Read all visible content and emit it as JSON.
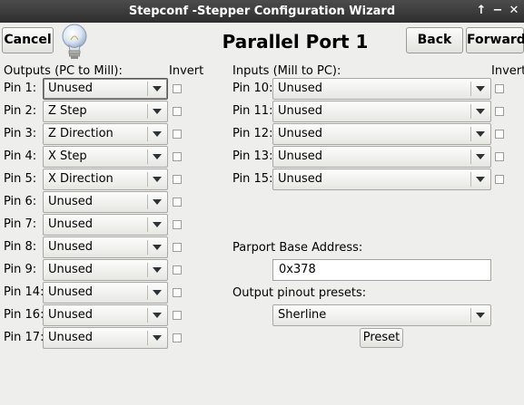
{
  "window": {
    "title": "Stepconf -Stepper Configuration Wizard",
    "controls": [
      "↑",
      "−",
      "✕"
    ]
  },
  "toolbar": {
    "cancel_label": "Cancel",
    "page_title": "Parallel Port 1",
    "back_label": "Back",
    "forward_label": "Forward"
  },
  "outputs": {
    "header": "Outputs (PC to Mill):",
    "invert_header": "Invert",
    "pins": [
      {
        "label": "Pin 1:",
        "value": "Unused"
      },
      {
        "label": "Pin 2:",
        "value": "Z Step"
      },
      {
        "label": "Pin 3:",
        "value": "Z Direction"
      },
      {
        "label": "Pin 4:",
        "value": "X Step"
      },
      {
        "label": "Pin 5:",
        "value": "X Direction"
      },
      {
        "label": "Pin 6:",
        "value": "Unused"
      },
      {
        "label": "Pin 7:",
        "value": "Unused"
      },
      {
        "label": "Pin 8:",
        "value": "Unused"
      },
      {
        "label": "Pin 9:",
        "value": "Unused"
      },
      {
        "label": "Pin 14:",
        "value": "Unused"
      },
      {
        "label": "Pin 16:",
        "value": "Unused"
      },
      {
        "label": "Pin 17:",
        "value": "Unused"
      }
    ]
  },
  "inputs": {
    "header": "Inputs (Mill to PC):",
    "invert_header": "Invert",
    "pins": [
      {
        "label": "Pin 10:",
        "value": "Unused"
      },
      {
        "label": "Pin 11:",
        "value": "Unused"
      },
      {
        "label": "Pin 12:",
        "value": "Unused"
      },
      {
        "label": "Pin 13:",
        "value": "Unused"
      },
      {
        "label": "Pin 15:",
        "value": "Unused"
      }
    ]
  },
  "parport": {
    "base_label": "Parport Base Address:",
    "base_value": "0x378",
    "presets_label": "Output pinout presets:",
    "preset_value": "Sherline",
    "preset_button": "Preset"
  }
}
